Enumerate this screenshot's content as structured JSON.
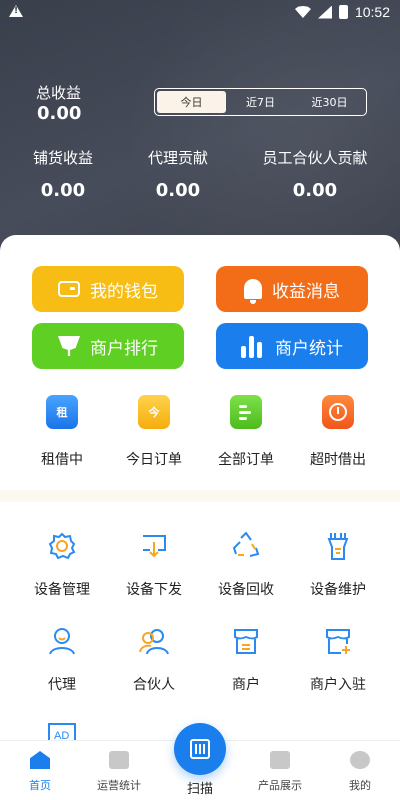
{
  "status_bar": {
    "time": "10:52"
  },
  "header": {
    "total_label": "总收益",
    "total_value": "0.00",
    "tabs": [
      {
        "label": "今日",
        "active": true
      },
      {
        "label": "近7日",
        "active": false
      },
      {
        "label": "近30日",
        "active": false
      }
    ],
    "stats": [
      {
        "label": "铺货收益",
        "value": "0.00"
      },
      {
        "label": "代理贡献",
        "value": "0.00"
      },
      {
        "label": "员工合伙人贡献",
        "value": "0.00"
      }
    ]
  },
  "action_buttons": {
    "wallet": "我的钱包",
    "messages": "收益消息",
    "ranking": "商户排行",
    "statistics": "商户统计"
  },
  "quick_orders": [
    {
      "label": "租借中",
      "icon": "rent-icon",
      "icon_text": "租"
    },
    {
      "label": "今日订单",
      "icon": "today-calendar-icon",
      "icon_text": "今"
    },
    {
      "label": "全部订单",
      "icon": "all-orders-icon"
    },
    {
      "label": "超时借出",
      "icon": "alarm-clock-icon"
    }
  ],
  "functions": [
    {
      "label": "设备管理",
      "icon": "gear-icon"
    },
    {
      "label": "设备下发",
      "icon": "device-dispatch-icon"
    },
    {
      "label": "设备回收",
      "icon": "recycle-icon"
    },
    {
      "label": "设备维护",
      "icon": "wrench-icon"
    },
    {
      "label": "代理",
      "icon": "agent-user-icon"
    },
    {
      "label": "合伙人",
      "icon": "partner-users-icon"
    },
    {
      "label": "商户",
      "icon": "shop-icon"
    },
    {
      "label": "商户入驻",
      "icon": "shop-add-icon"
    },
    {
      "label": "",
      "icon": "ad-icon",
      "icon_text": "AD"
    }
  ],
  "bottom_nav": {
    "home": "首页",
    "operations": "运营统计",
    "scan": "扫描",
    "products": "产品展示",
    "mine": "我的"
  },
  "colors": {
    "header_bg": "#40444f",
    "wallet": "#f8bd14",
    "messages": "#f36c18",
    "ranking": "#5fcf23",
    "statistics": "#1a7fec",
    "accent": "#1a7fec"
  }
}
